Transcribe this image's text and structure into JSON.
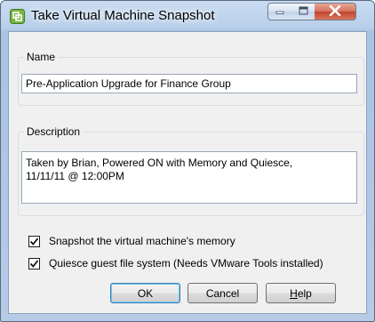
{
  "window": {
    "title": "Take Virtual Machine Snapshot"
  },
  "name_group": {
    "legend": "Name",
    "value": "Pre-Application Upgrade for Finance Group"
  },
  "description_group": {
    "legend": "Description",
    "line1": "Taken by Brian, Powered ON with Memory and Quiesce,",
    "line2": "11/11/11 @ 12:00PM"
  },
  "options": {
    "snapshot_memory": {
      "label": "Snapshot the virtual machine's memory",
      "checked": true
    },
    "quiesce": {
      "label": "Quiesce guest file system (Needs VMware Tools installed)",
      "checked": true
    }
  },
  "buttons": {
    "ok": "OK",
    "cancel": "Cancel",
    "help_mnemonic": "H",
    "help_rest": "elp"
  },
  "icons": {
    "app": "vmware-snapshot-icon",
    "minimize": "minimize-icon",
    "maximize": "maximize-icon",
    "close": "close-icon",
    "check": "checkmark-icon"
  },
  "colors": {
    "titlebar": "#b9cfe9",
    "close_button": "#c2442c",
    "dialog_bg": "#f0f0f0",
    "default_button_border": "#3c7fb1"
  }
}
